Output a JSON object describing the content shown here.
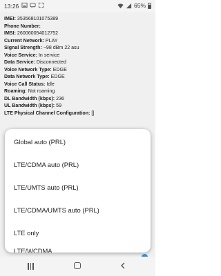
{
  "status": {
    "time": "13:26",
    "battery": "65%",
    "colors": {
      "bar_bg": "#f4f4f4",
      "accent": "#2b8de0"
    }
  },
  "info_rows": [
    {
      "label": "IMEI:",
      "value": " 353568101075389"
    },
    {
      "label": "Phone Number:",
      "value": ""
    },
    {
      "label": "IMSI:",
      "value": " 260060054012752"
    },
    {
      "label": "Current Network:",
      "value": " PLAY"
    },
    {
      "label": "Signal Strength:",
      "value": " −98 dBm   22 asu"
    },
    {
      "label": "Voice Service:",
      "value": " In service"
    },
    {
      "label": "Data Service:",
      "value": " Disconnected"
    },
    {
      "label": "Voice Network Type:",
      "value": " EDGE"
    },
    {
      "label": "Data Network Type:",
      "value": " EDGE"
    },
    {
      "label": "Voice Call Status:",
      "value": " Idle"
    },
    {
      "label": "Roaming:",
      "value": " Not roaming"
    },
    {
      "label": "DL Bandwidth (kbps):",
      "value": " 236"
    },
    {
      "label": "UL Bandwidth (kbps):",
      "value": " 59"
    },
    {
      "label": "LTE Physical Channel Configuration:",
      "value": " []"
    }
  ],
  "network_mode_options": [
    "Global auto (PRL)",
    "LTE/CDMA auto (PRL)",
    "LTE/UMTS auto (PRL)",
    "LTE/CDMA/UMTS auto (PRL)",
    "LTE only",
    "LTE/WCDMA"
  ],
  "nav_icons": [
    "recents-icon",
    "home-icon",
    "back-icon"
  ]
}
